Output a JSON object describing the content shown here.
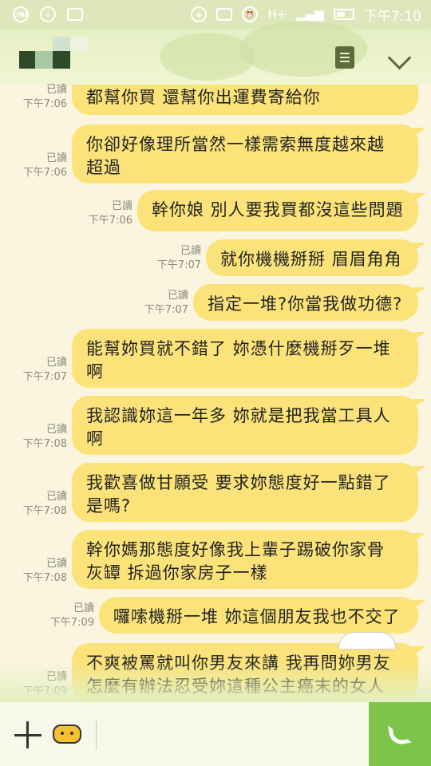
{
  "status_bar": {
    "time": "下午7:10",
    "network": "H+"
  },
  "messages": [
    {
      "side": "right",
      "read": "已讀",
      "time": "下午7:06",
      "lines": [
        "都幫你買 還幫你出運費寄給你"
      ]
    },
    {
      "side": "right",
      "read": "已讀",
      "time": "下午7:06",
      "lines": [
        "你卻好像理所當然一樣需索無度越來越",
        "超過"
      ]
    },
    {
      "side": "right",
      "read": "已讀",
      "time": "下午7:06",
      "lines": [
        "幹你娘 別人要我買都沒這些問題"
      ]
    },
    {
      "side": "right",
      "read": "已讀",
      "time": "下午7:07",
      "lines": [
        "就你機機掰掰 眉眉角角"
      ]
    },
    {
      "side": "right",
      "read": "已讀",
      "time": "下午7:07",
      "lines": [
        "指定一堆?你當我做功德?"
      ]
    },
    {
      "side": "right",
      "read": "已讀",
      "time": "下午7:07",
      "lines": [
        "能幫妳買就不錯了 妳憑什麼機掰歹一堆",
        "啊"
      ]
    },
    {
      "side": "right",
      "read": "已讀",
      "time": "下午7:08",
      "lines": [
        "我認識妳這一年多 妳就是把我當工具人",
        "啊"
      ]
    },
    {
      "side": "right",
      "read": "已讀",
      "time": "下午7:08",
      "lines": [
        "我歡喜做甘願受 要求妳態度好一點錯了",
        "是嗎?"
      ]
    },
    {
      "side": "right",
      "read": "已讀",
      "time": "下午7:08",
      "lines": [
        "幹你媽那態度好像我上輩子踢破你家骨",
        "灰罈 拆過你家房子一樣"
      ]
    },
    {
      "side": "right",
      "read": "已讀",
      "time": "下午7:09",
      "lines": [
        "囉嗦機掰一堆 妳這個朋友我也不交了"
      ]
    },
    {
      "side": "right",
      "read": "已讀",
      "time": "下午7:09",
      "lines": [
        "不爽被罵就叫你男友來講 我再問妳男友",
        "怎麼有辦法忍受妳這種公主癌末的女人"
      ]
    }
  ],
  "footer": {
    "plus_icon": "plus-icon",
    "sticker_icon": "bee-sticker-icon",
    "call_icon": "phone-icon"
  },
  "colors": {
    "bubble": "#fbe37a",
    "background": "#fbf5df",
    "call_button": "#7cc44a"
  }
}
